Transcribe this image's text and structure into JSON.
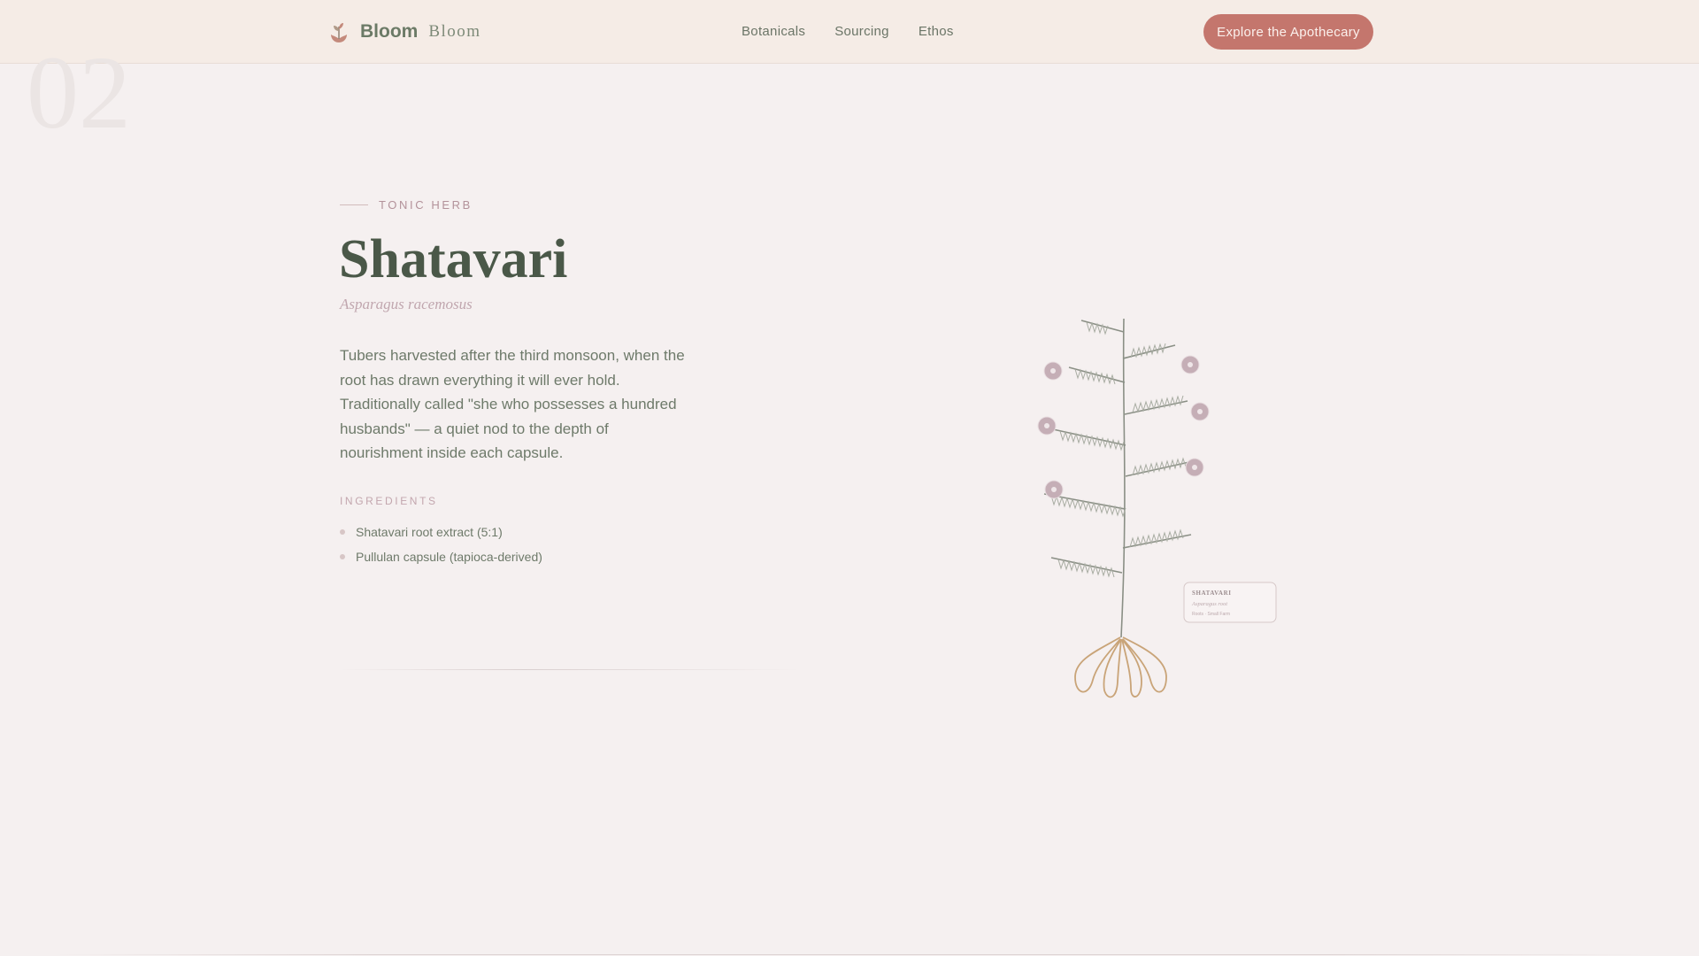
{
  "header": {
    "brand_name": "Bloom",
    "brand_sub": "Bloom",
    "nav": [
      "Botanicals",
      "Sourcing",
      "Ethos"
    ],
    "cta_label": "Explore the Apothecary"
  },
  "section": {
    "number": "02",
    "eyebrow": "TONIC HERB",
    "title": "Shatavari",
    "latin_name": "Asparagus racemosus",
    "description": "Tubers harvested after the third monsoon, when the root has drawn everything it will ever hold. Traditionally called \"she who possesses a hundred husbands\" — a quiet nod to the depth of nourishment inside each capsule.",
    "ingredients_label": "INGREDIENTS",
    "ingredients": [
      "Shatavari root extract (5:1)",
      "Pullulan capsule (tapioca-derived)"
    ]
  },
  "illustration": {
    "tag_title": "SHATAVARI",
    "tag_latin": "Asparagus root",
    "tag_small": "Roots · Small Farm"
  },
  "colors": {
    "accent": "#c4766d",
    "background": "#f5f0f0",
    "header_background": "#f5ece6",
    "heading": "#4a5848",
    "stem": "#8a8f85",
    "root": "#c9a478",
    "flower": "#c5aeb6"
  }
}
